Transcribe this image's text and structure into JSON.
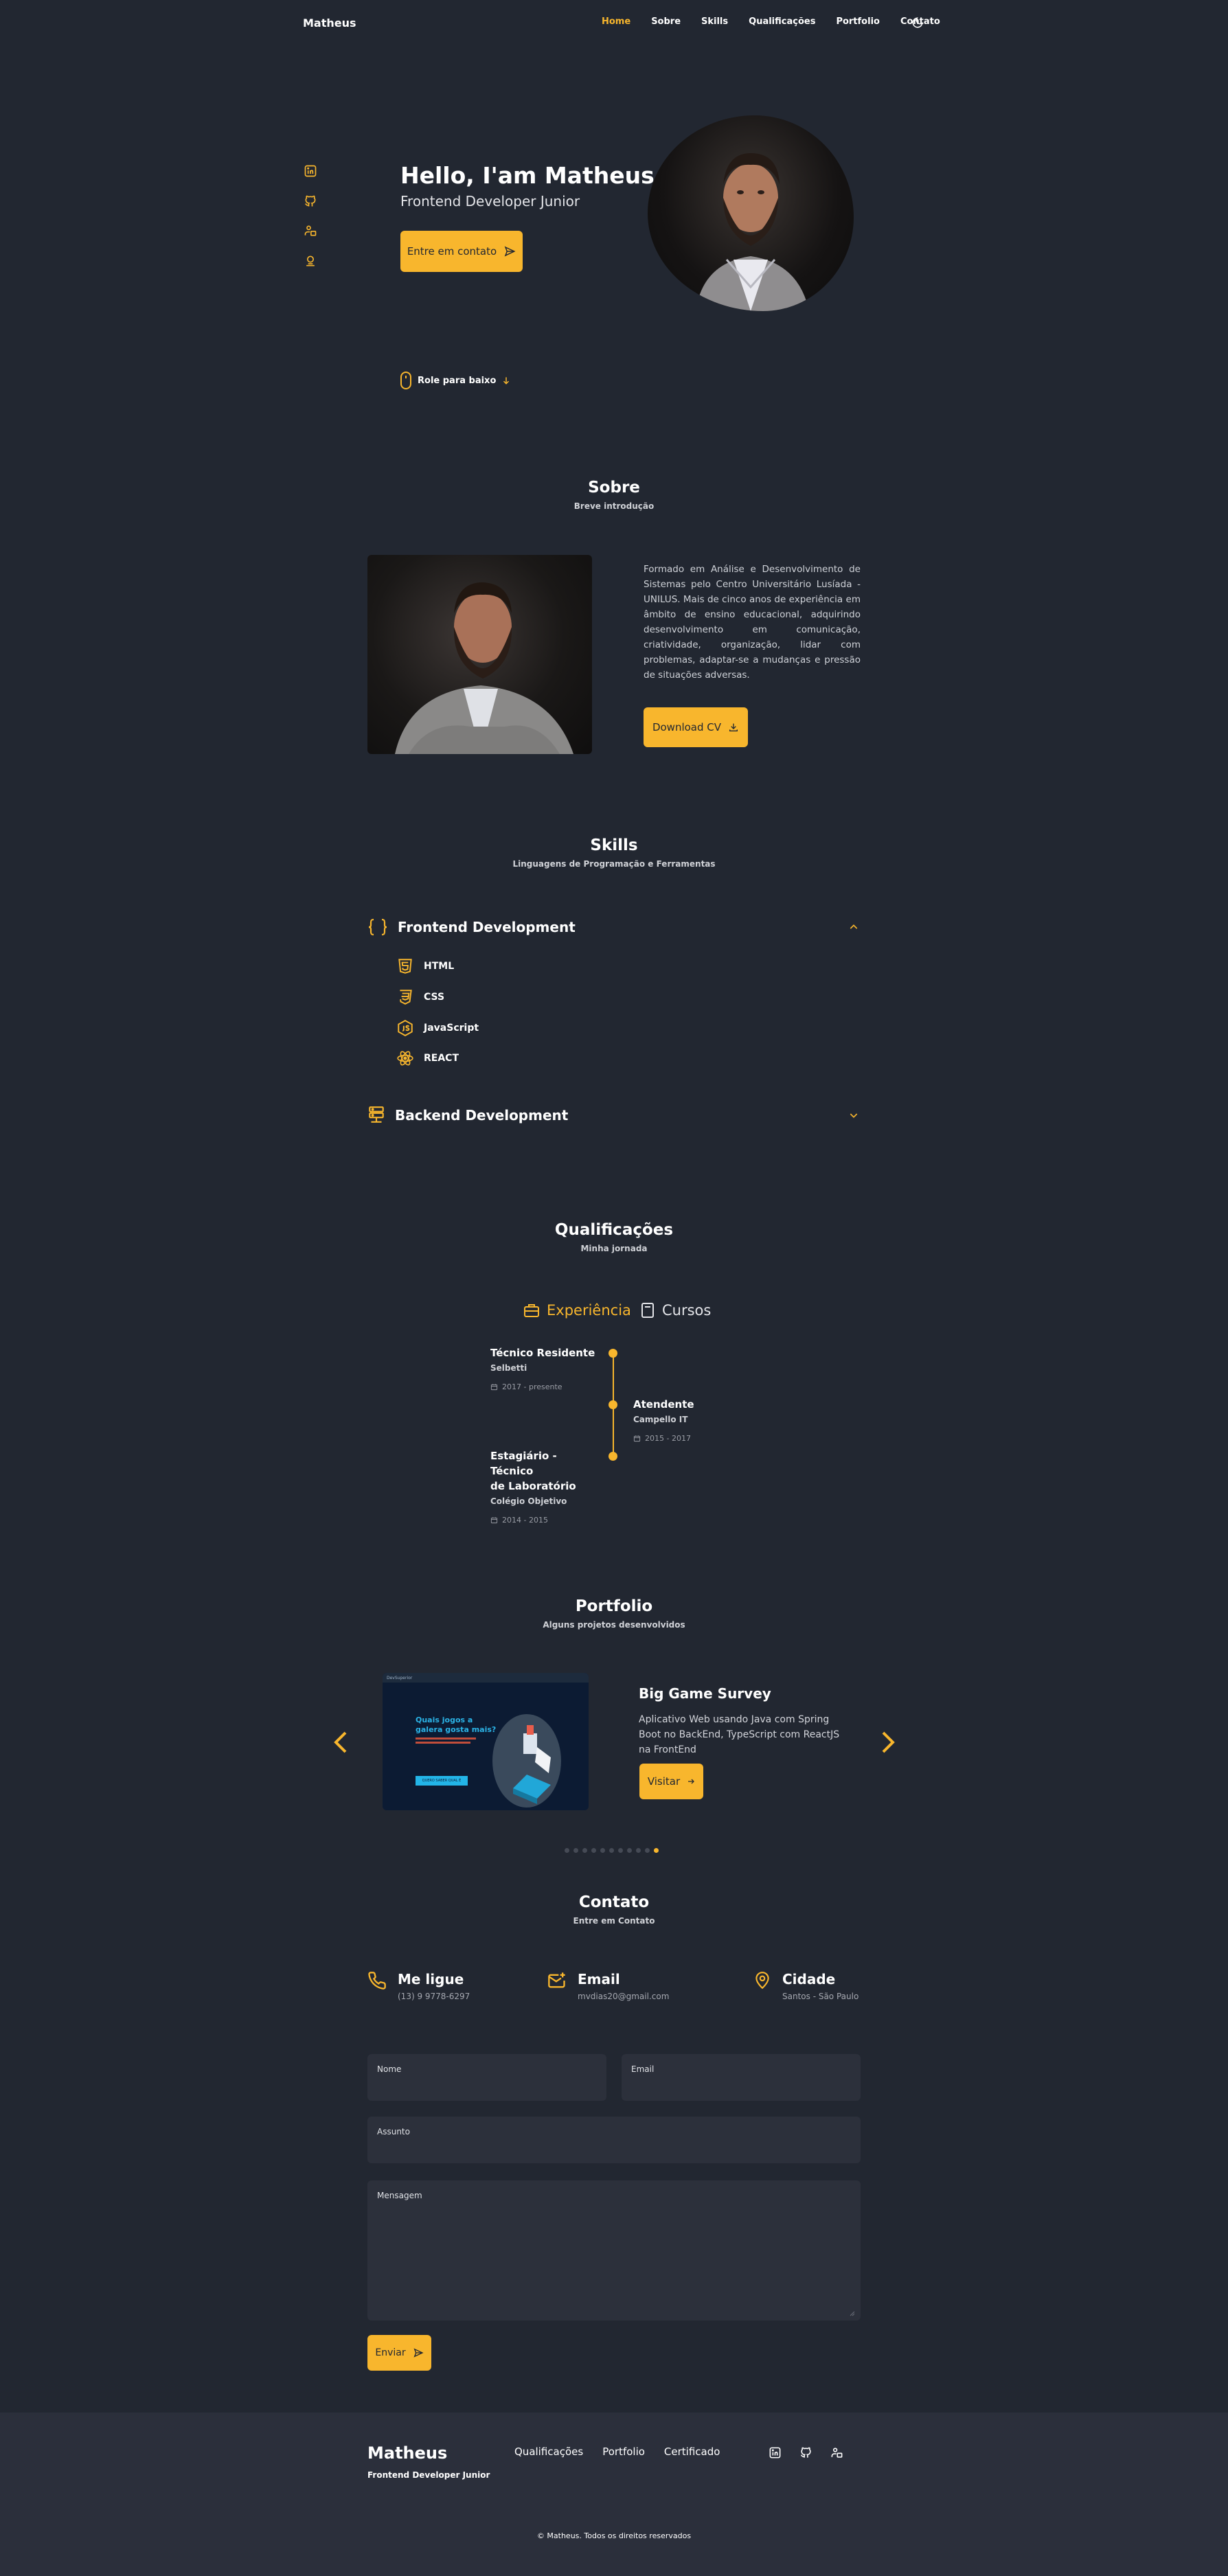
{
  "nav": {
    "brand": "Matheus",
    "links": [
      "Home",
      "Sobre",
      "Skills",
      "Qualificações",
      "Portfolio",
      "Contato"
    ],
    "active": "Home"
  },
  "hero": {
    "title": "Hello, I'am Matheus",
    "subtitle": "Frontend Developer Junior",
    "cta": "Entre em contato",
    "scroll": "Role para baixo"
  },
  "about": {
    "title": "Sobre",
    "subtitle": "Breve introdução",
    "text": "Formado em Análise e Desenvolvimento de Sistemas pelo Centro Universitário Lusíada - UNILUS. Mais de cinco anos de experiência em âmbito de ensino educacional, adquirindo desenvolvimento em comunicação, criatividade, organização, lidar com problemas, adaptar-se a mudanças e pressão de situações adversas.",
    "button": "Download CV"
  },
  "skills": {
    "title": "Skills",
    "subtitle": "Linguagens de Programação e Ferramentas",
    "frontend": "Frontend Development",
    "items": [
      "HTML",
      "CSS",
      "JavaScript",
      "REACT"
    ],
    "backend": "Backend Development"
  },
  "qualifications": {
    "title": "Qualificações",
    "subtitle": "Minha jornada",
    "tab_experience": "Experiência",
    "tab_courses": "Cursos",
    "entries": [
      {
        "title_1": "Técnico Residente",
        "title_2": "",
        "company": "Selbetti",
        "date": "2017 - presente"
      },
      {
        "title_1": "Atendente",
        "title_2": "",
        "company": "Campello IT",
        "date": "2015 - 2017"
      },
      {
        "title_1": "Estagiário - Técnico",
        "title_2": "de Laboratório",
        "company": "Colégio Objetivo",
        "date": "2014 - 2015"
      }
    ]
  },
  "portfolio": {
    "title": "Portfolio",
    "subtitle": "Alguns projetos desenvolvidos",
    "project_title": "Big Game Survey",
    "project_desc": "Aplicativo Web usando Java com Spring Boot no BackEnd, TypeScript com ReactJS na FrontEnd",
    "button": "Visitar",
    "shot_heading_1": "Quais jogos a",
    "shot_heading_2": "galera gosta mais?",
    "shot_brand": "DevSuperior",
    "shot_button": "QUERO SABER QUAL É",
    "pages": 11,
    "active_page": 11
  },
  "contact": {
    "title": "Contato",
    "subtitle": "Entre em Contato",
    "phone_label": "Me ligue",
    "phone_value": "(13) 9 9778-6297",
    "email_label": "Email",
    "email_value": "mvdias20@gmail.com",
    "city_label": "Cidade",
    "city_value": "Santos - São Paulo",
    "form": {
      "name_label": "Nome",
      "email_label": "Email",
      "subject_label": "Assunto",
      "message_label": "Mensagem",
      "submit": "Enviar"
    }
  },
  "footer": {
    "brand": "Matheus",
    "role": "Frontend Developer Junior",
    "links": [
      "Qualificações",
      "Portfolio",
      "Certificado"
    ],
    "copyright": "© Matheus. Todos os direitos reservados"
  },
  "colors": {
    "background": "#222731",
    "accent": "#f8b62d",
    "surface": "#2c303b",
    "footer": "#2b2f3b"
  },
  "icons": {
    "social": [
      "linkedin-icon",
      "github-icon",
      "portfolio-user-icon",
      "certificate-icon"
    ],
    "theme": "moon-icon"
  }
}
